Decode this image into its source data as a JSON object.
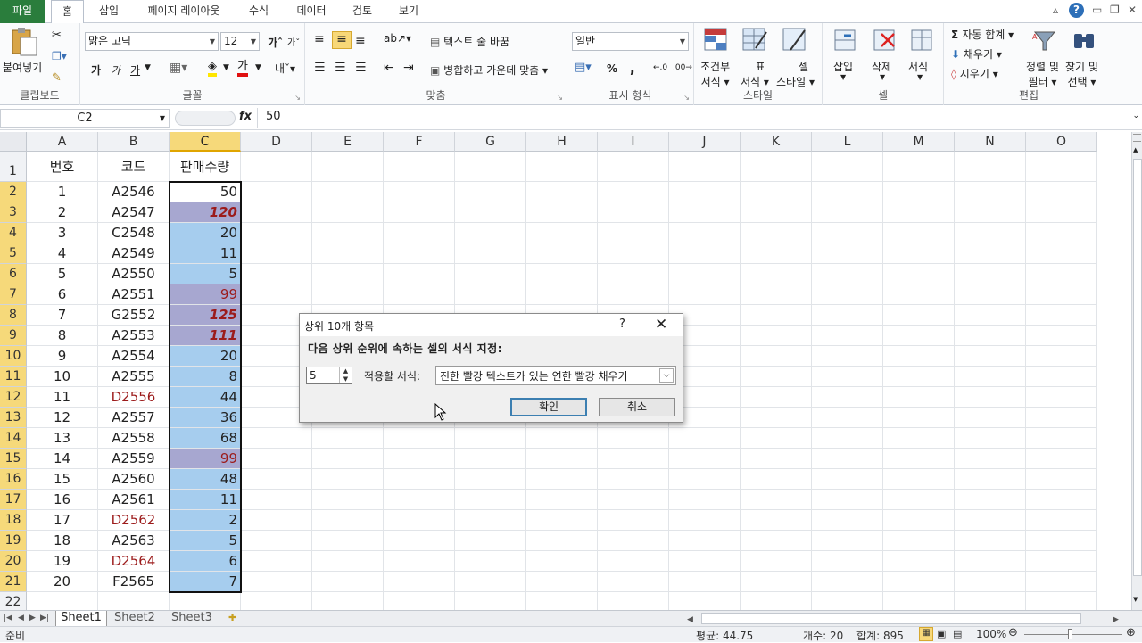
{
  "tabs": [
    "파일",
    "홈",
    "삽입",
    "페이지 레이아웃",
    "수식",
    "데이터",
    "검토",
    "보기"
  ],
  "ribbon": {
    "clipboard": {
      "paste": "붙여넣기",
      "label": "클립보드"
    },
    "font": {
      "name": "맑은 고딕",
      "size": "12",
      "bold": "가",
      "italic": "가",
      "underline": "가",
      "label": "글꼴"
    },
    "align": {
      "wrap": "텍스트 줄 바꿈",
      "merge": "병합하고 가운데 맞춤",
      "label": "맞춤"
    },
    "number": {
      "format": "일반",
      "percent": "%",
      "comma": ",",
      "label": "표시 형식"
    },
    "styles": {
      "cond": "조건부\n서식",
      "cond1": "조건부",
      "cond2": "서식",
      "table1": "표",
      "table2": "서식",
      "cell1": "셀",
      "cell2": "스타일",
      "label": "스타일"
    },
    "cells": {
      "insert": "삽입",
      "delete": "삭제",
      "format": "서식",
      "label": "셀"
    },
    "edit": {
      "autosum": "자동 합계",
      "fill": "채우기",
      "clear": "지우기",
      "sort1": "정렬 및",
      "sort2": "필터",
      "find1": "찾기 및",
      "find2": "선택",
      "label": "편집"
    }
  },
  "formula_bar": {
    "name_box": "C2",
    "fx": "fx",
    "value": "50"
  },
  "columns": [
    "A",
    "B",
    "C",
    "D",
    "E",
    "F",
    "G",
    "H",
    "I",
    "J",
    "K",
    "L",
    "M",
    "N",
    "O"
  ],
  "header_row": {
    "num": "1",
    "a": "번호",
    "b": "코드",
    "c": "판매수량"
  },
  "rows": [
    {
      "r": "2",
      "a": "1",
      "b": "A2546",
      "c": "50",
      "fill": "none",
      "fmt": ""
    },
    {
      "r": "3",
      "a": "2",
      "b": "A2547",
      "c": "120",
      "fill": "purple",
      "fmt": "bi"
    },
    {
      "r": "4",
      "a": "3",
      "b": "C2548",
      "c": "20",
      "fill": "blue",
      "fmt": ""
    },
    {
      "r": "5",
      "a": "4",
      "b": "A2549",
      "c": "11",
      "fill": "blue",
      "fmt": ""
    },
    {
      "r": "6",
      "a": "5",
      "b": "A2550",
      "c": "5",
      "fill": "blue",
      "fmt": ""
    },
    {
      "r": "7",
      "a": "6",
      "b": "A2551",
      "c": "99",
      "fill": "purple",
      "fmt": "red"
    },
    {
      "r": "8",
      "a": "7",
      "b": "G2552",
      "c": "125",
      "fill": "purple",
      "fmt": "bi"
    },
    {
      "r": "9",
      "a": "8",
      "b": "A2553",
      "c": "111",
      "fill": "purple",
      "fmt": "bi"
    },
    {
      "r": "10",
      "a": "9",
      "b": "A2554",
      "c": "20",
      "fill": "blue",
      "fmt": ""
    },
    {
      "r": "11",
      "a": "10",
      "b": "A2555",
      "c": "8",
      "fill": "blue",
      "fmt": ""
    },
    {
      "r": "12",
      "a": "11",
      "b": "D2556",
      "c": "44",
      "fill": "blue",
      "fmt": "",
      "bred": true
    },
    {
      "r": "13",
      "a": "12",
      "b": "A2557",
      "c": "36",
      "fill": "blue",
      "fmt": ""
    },
    {
      "r": "14",
      "a": "13",
      "b": "A2558",
      "c": "68",
      "fill": "blue",
      "fmt": ""
    },
    {
      "r": "15",
      "a": "14",
      "b": "A2559",
      "c": "99",
      "fill": "purple",
      "fmt": "red"
    },
    {
      "r": "16",
      "a": "15",
      "b": "A2560",
      "c": "48",
      "fill": "blue",
      "fmt": ""
    },
    {
      "r": "17",
      "a": "16",
      "b": "A2561",
      "c": "11",
      "fill": "blue",
      "fmt": ""
    },
    {
      "r": "18",
      "a": "17",
      "b": "D2562",
      "c": "2",
      "fill": "blue",
      "fmt": "",
      "bred": true
    },
    {
      "r": "19",
      "a": "18",
      "b": "A2563",
      "c": "5",
      "fill": "blue",
      "fmt": ""
    },
    {
      "r": "20",
      "a": "19",
      "b": "D2564",
      "c": "6",
      "fill": "blue",
      "fmt": "",
      "bred": true
    },
    {
      "r": "21",
      "a": "20",
      "b": "F2565",
      "c": "7",
      "fill": "blue",
      "fmt": ""
    }
  ],
  "last_row": "22",
  "sheets": [
    "Sheet1",
    "Sheet2",
    "Sheet3"
  ],
  "status": {
    "ready": "준비",
    "average": "평균: 44.75",
    "count": "개수: 20",
    "sum": "합계: 895",
    "zoom": "100%"
  },
  "dialog": {
    "title": "상위 10개 항목",
    "help": "?",
    "message": "다음 상위 순위에 속하는 셀의 서식 지정:",
    "spin_value": "5",
    "format_label": "적용할 서식:",
    "format_value": "진한 빨강 텍스트가 있는 연한 빨강 채우기",
    "ok": "확인",
    "cancel": "취소"
  },
  "colors": {
    "file_tab": "#2a7d3c",
    "selected_header": "#f6d97a",
    "fill_blue": "#a6cdee",
    "fill_purple": "#a7a7d0",
    "dark_red_text": "#9c1b1b"
  }
}
